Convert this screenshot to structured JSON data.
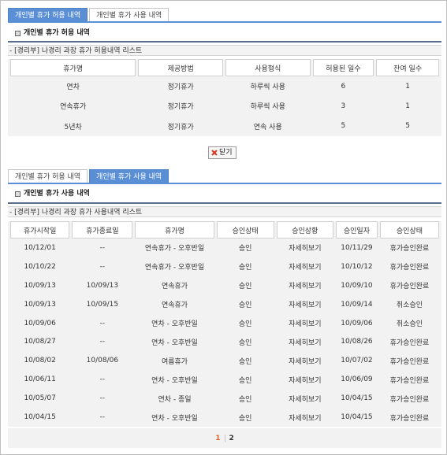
{
  "tabs": [
    "개인별 휴가 허용 내역",
    "개인별 휴가 사용 내역"
  ],
  "allow": {
    "title": "개인별 휴가 허용 내역",
    "list_caption": "- [경리부] 나경리 과장 휴가 허용내역 리스트",
    "headers": [
      "휴가명",
      "제공방법",
      "사용형식",
      "허용된 일수",
      "잔여 일수"
    ],
    "rows": [
      [
        "연차",
        "정기휴가",
        "하루씩 사용",
        "6",
        "1"
      ],
      [
        "연속휴가",
        "정기휴가",
        "하루씩 사용",
        "3",
        "1"
      ],
      [
        "5년차",
        "정기휴가",
        "연속 사용",
        "5",
        "5"
      ]
    ]
  },
  "close_label": "닫기",
  "usage": {
    "title": "개인별 휴가 사용 내역",
    "list_caption": "- [경리부] 나경리 과장 휴가 사용내역 리스트",
    "headers": [
      "휴가시작일",
      "휴가종료일",
      "휴가명",
      "승인상태",
      "승인상황",
      "승인일자",
      "승인상태"
    ],
    "rows": [
      [
        "10/12/01",
        "--",
        "연속휴가 - 오후반일",
        "승인",
        "자세히보기",
        "10/11/29",
        "휴가승인완료"
      ],
      [
        "10/10/22",
        "--",
        "연속휴가 - 오후반일",
        "승인",
        "자세히보기",
        "10/10/12",
        "휴가승인완료"
      ],
      [
        "10/09/13",
        "10/09/13",
        "연속휴가",
        "승인",
        "자세히보기",
        "10/09/10",
        "휴가승인완료"
      ],
      [
        "10/09/13",
        "10/09/15",
        "연속휴가",
        "승인",
        "자세히보기",
        "10/09/14",
        "취소승인"
      ],
      [
        "10/09/06",
        "--",
        "연차 - 오후반일",
        "승인",
        "자세히보기",
        "10/09/06",
        "취소승인"
      ],
      [
        "10/08/27",
        "--",
        "연차 - 오후반일",
        "승인",
        "자세히보기",
        "10/08/26",
        "휴가승인완료"
      ],
      [
        "10/08/02",
        "10/08/06",
        "여름휴가",
        "승인",
        "자세히보기",
        "10/07/02",
        "휴가승인완료"
      ],
      [
        "10/06/11",
        "--",
        "연차 - 오후반일",
        "승인",
        "자세히보기",
        "10/06/09",
        "휴가승인완료"
      ],
      [
        "10/05/07",
        "--",
        "연차 - 종일",
        "승인",
        "자세히보기",
        "10/04/15",
        "휴가승인완료"
      ],
      [
        "10/04/15",
        "--",
        "연차 - 오후반일",
        "승인",
        "자세히보기",
        "10/04/15",
        "휴가승인완료"
      ]
    ]
  },
  "pagination": {
    "pages": [
      "1",
      "2"
    ],
    "current": "1"
  },
  "colors": {
    "accent": "#5a8fd6",
    "current_page": "#e06a2a",
    "close_icon": "#d9361e"
  },
  "icons": {
    "section_marker": "square-bullet-icon",
    "close": "close-x-icon"
  }
}
